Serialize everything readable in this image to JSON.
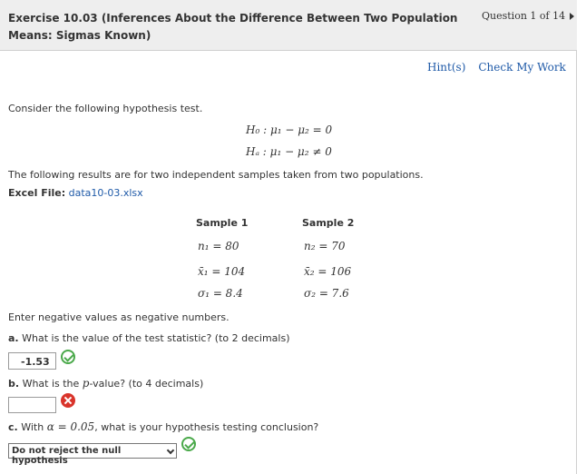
{
  "header": {
    "title": "Exercise 10.03 (Inferences About the Difference Between Two Population Means: Sigmas Known)",
    "question_counter": "Question 1 of 14"
  },
  "toolbar": {
    "hint_label": "Hint(s)",
    "check_label": "Check My Work"
  },
  "problem": {
    "intro": "Consider the following hypothesis test.",
    "h0": "H₀ : μ₁ − μ₂ = 0",
    "ha": "Hₐ : μ₁ − μ₂ ≠ 0",
    "results_text": "The following results are for two independent samples taken from two populations.",
    "excel_label": "Excel File:",
    "excel_link": "data10-03.xlsx"
  },
  "samples": {
    "sample1": {
      "header": "Sample 1",
      "n": "n₁ = 80",
      "xbar": "x̄₁ = 104",
      "sigma": "σ₁ = 8.4"
    },
    "sample2": {
      "header": "Sample 2",
      "n": "n₂ = 70",
      "xbar": "x̄₂ = 106",
      "sigma": "σ₂ = 7.6"
    }
  },
  "instructions": "Enter negative values as negative numbers.",
  "questions": {
    "a": {
      "label_prefix": "a.",
      "text": "What is the value of the test statistic? (to 2 decimals)",
      "answer": "-1.53",
      "status": "correct"
    },
    "b": {
      "label_prefix": "b.",
      "text": "What is the ",
      "p_symbol": "p",
      "text_after": "-value? (to 4 decimals)",
      "answer": "",
      "status": "incorrect"
    },
    "c": {
      "label_prefix": "c.",
      "text_before": "With ",
      "alpha_expr": "α = 0.05",
      "text_after": ", what is your hypothesis testing conclusion?",
      "selected": "Do not reject the null hypothesis",
      "status": "correct"
    }
  },
  "colors": {
    "link": "#1f5aa8",
    "correct": "#4aa94a",
    "incorrect": "#d9342b",
    "header_bg": "#eeeeee"
  },
  "icons": {
    "next": "triangle-right-icon",
    "correct": "check-circle-icon",
    "incorrect": "x-circle-icon",
    "dropdown": "chevron-down-icon"
  }
}
